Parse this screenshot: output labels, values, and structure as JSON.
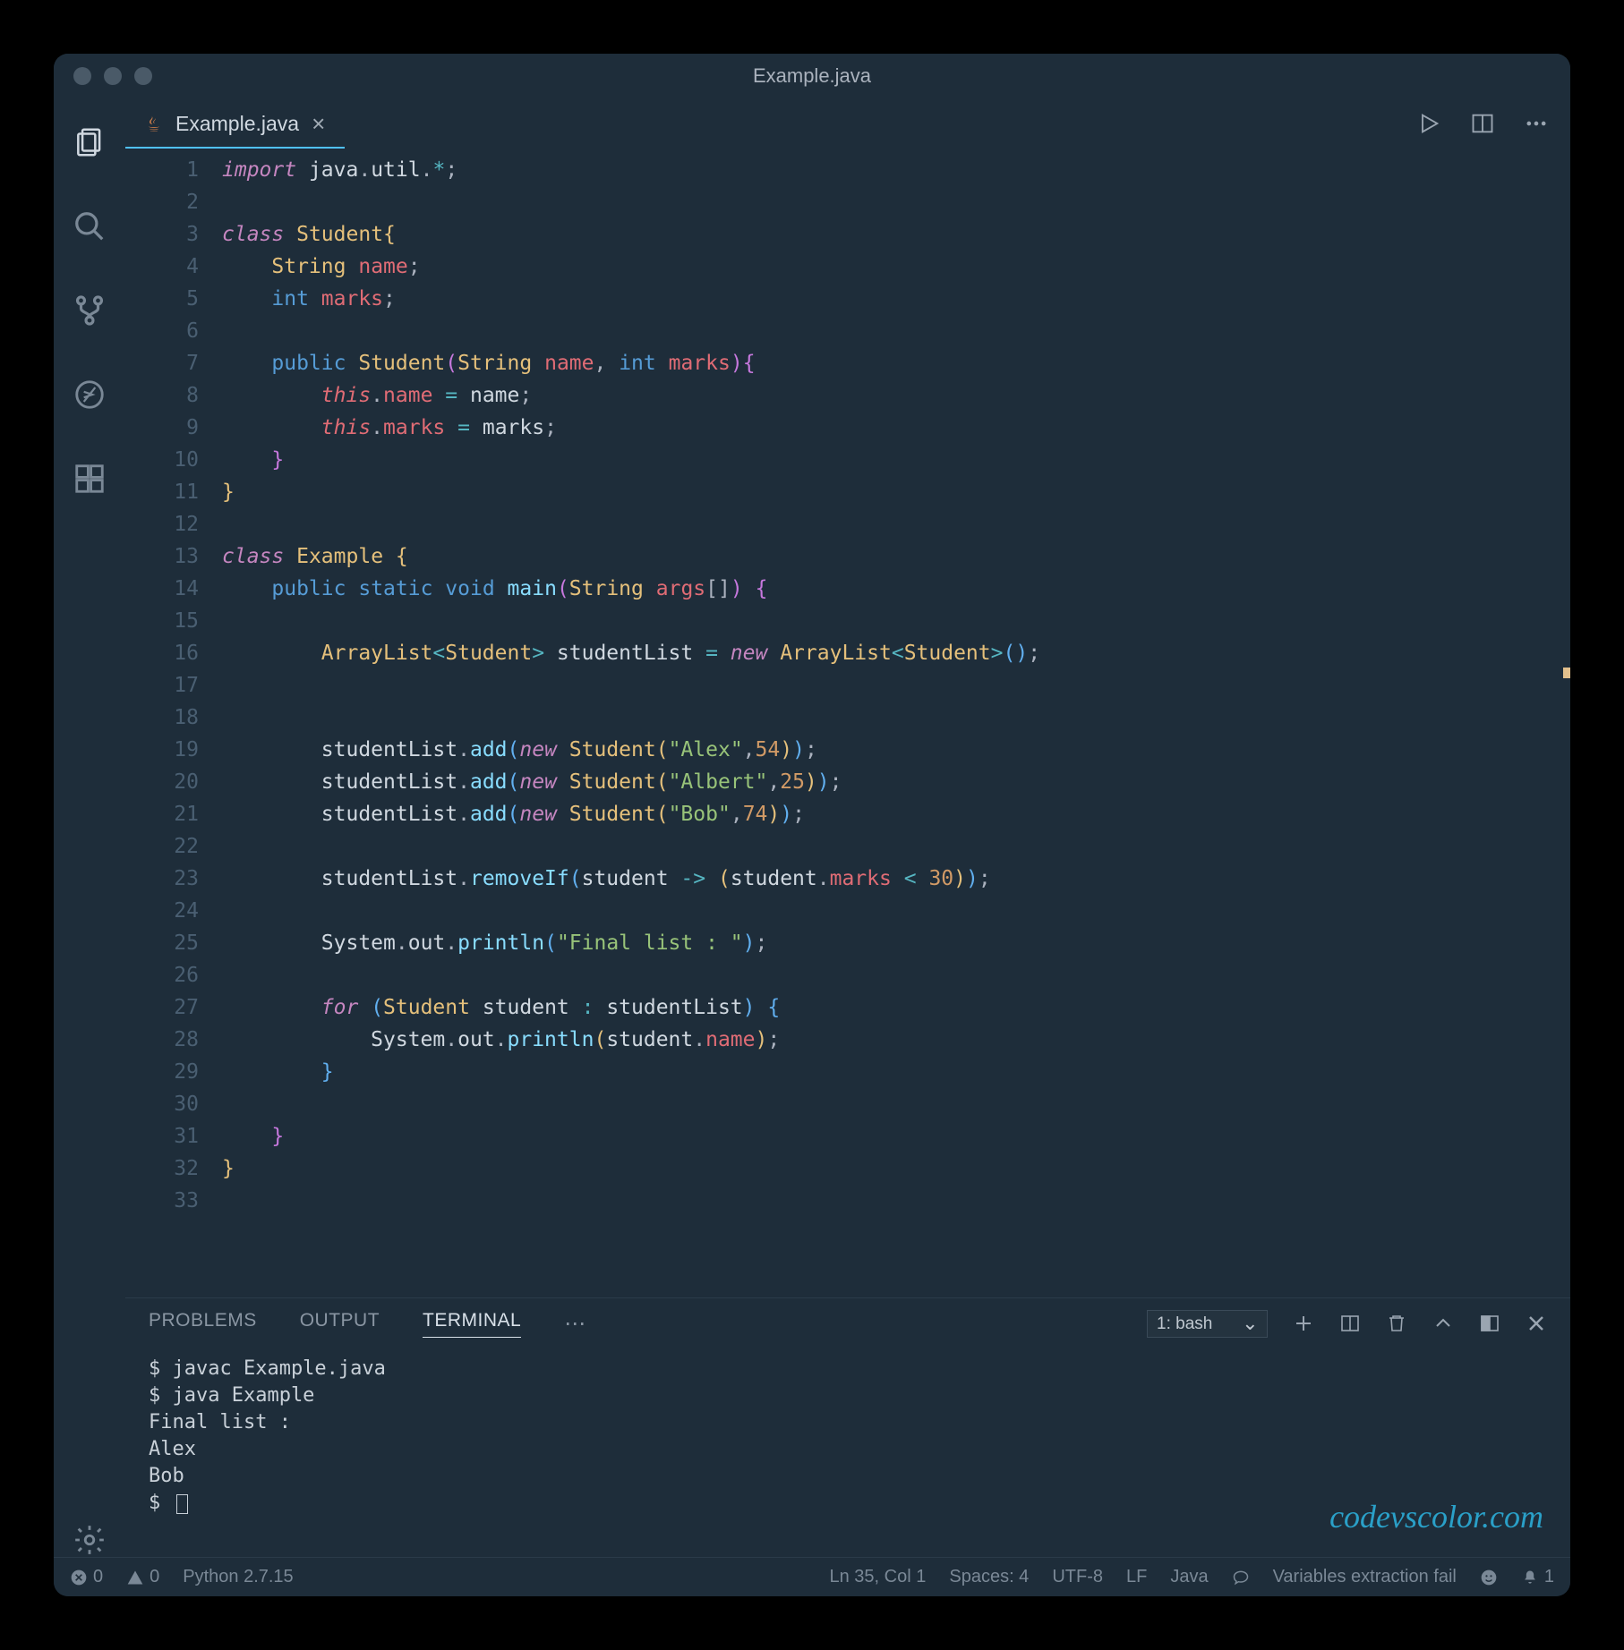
{
  "title": "Example.java",
  "tab": {
    "label": "Example.java"
  },
  "code_lines": [
    [
      [
        "kw",
        "import"
      ],
      [
        "id",
        " java"
      ],
      [
        "punct",
        "."
      ],
      [
        "id",
        "util"
      ],
      [
        "punct",
        "."
      ],
      [
        "op",
        "*"
      ],
      [
        "punct",
        ";"
      ]
    ],
    [],
    [
      [
        "kw",
        "class"
      ],
      [
        "id",
        " "
      ],
      [
        "type",
        "Student"
      ],
      [
        "paren-y",
        "{"
      ]
    ],
    [
      [
        "id",
        "    "
      ],
      [
        "type",
        "String"
      ],
      [
        "id",
        " "
      ],
      [
        "prop",
        "name"
      ],
      [
        "punct",
        ";"
      ]
    ],
    [
      [
        "id",
        "    "
      ],
      [
        "mod",
        "int"
      ],
      [
        "id",
        " "
      ],
      [
        "prop",
        "marks"
      ],
      [
        "punct",
        ";"
      ]
    ],
    [],
    [
      [
        "id",
        "    "
      ],
      [
        "mod",
        "public"
      ],
      [
        "id",
        " "
      ],
      [
        "type",
        "Student"
      ],
      [
        "paren-p",
        "("
      ],
      [
        "type",
        "String"
      ],
      [
        "id",
        " "
      ],
      [
        "prop",
        "name"
      ],
      [
        "punct",
        ","
      ],
      [
        "id",
        " "
      ],
      [
        "mod",
        "int"
      ],
      [
        "id",
        " "
      ],
      [
        "prop",
        "marks"
      ],
      [
        "paren-p",
        ")"
      ],
      [
        "paren-p",
        "{"
      ]
    ],
    [
      [
        "id",
        "        "
      ],
      [
        "self",
        "this"
      ],
      [
        "punct",
        "."
      ],
      [
        "prop",
        "name"
      ],
      [
        "id",
        " "
      ],
      [
        "op",
        "="
      ],
      [
        "id",
        " name"
      ],
      [
        "punct",
        ";"
      ]
    ],
    [
      [
        "id",
        "        "
      ],
      [
        "self",
        "this"
      ],
      [
        "punct",
        "."
      ],
      [
        "prop",
        "marks"
      ],
      [
        "id",
        " "
      ],
      [
        "op",
        "="
      ],
      [
        "id",
        " marks"
      ],
      [
        "punct",
        ";"
      ]
    ],
    [
      [
        "id",
        "    "
      ],
      [
        "paren-p",
        "}"
      ]
    ],
    [
      [
        "paren-y",
        "}"
      ]
    ],
    [],
    [
      [
        "kw",
        "class"
      ],
      [
        "id",
        " "
      ],
      [
        "type",
        "Example"
      ],
      [
        "id",
        " "
      ],
      [
        "paren-y",
        "{"
      ]
    ],
    [
      [
        "id",
        "    "
      ],
      [
        "mod",
        "public"
      ],
      [
        "id",
        " "
      ],
      [
        "mod",
        "static"
      ],
      [
        "id",
        " "
      ],
      [
        "mod",
        "void"
      ],
      [
        "id",
        " "
      ],
      [
        "fn",
        "main"
      ],
      [
        "paren-p",
        "("
      ],
      [
        "type",
        "String"
      ],
      [
        "id",
        " "
      ],
      [
        "prop",
        "args"
      ],
      [
        "punct",
        "[]"
      ],
      [
        "paren-p",
        ")"
      ],
      [
        "id",
        " "
      ],
      [
        "paren-p",
        "{"
      ]
    ],
    [],
    [
      [
        "id",
        "        "
      ],
      [
        "type",
        "ArrayList"
      ],
      [
        "op",
        "<"
      ],
      [
        "type",
        "Student"
      ],
      [
        "op",
        ">"
      ],
      [
        "id",
        " studentList "
      ],
      [
        "op",
        "="
      ],
      [
        "id",
        " "
      ],
      [
        "kw",
        "new"
      ],
      [
        "id",
        " "
      ],
      [
        "type",
        "ArrayList"
      ],
      [
        "op",
        "<"
      ],
      [
        "type",
        "Student"
      ],
      [
        "op",
        ">"
      ],
      [
        "paren-b",
        "()"
      ],
      [
        "punct",
        ";"
      ]
    ],
    [],
    [],
    [
      [
        "id",
        "        studentList"
      ],
      [
        "punct",
        "."
      ],
      [
        "fn",
        "add"
      ],
      [
        "paren-b",
        "("
      ],
      [
        "kw",
        "new"
      ],
      [
        "id",
        " "
      ],
      [
        "type",
        "Student"
      ],
      [
        "paren-y",
        "("
      ],
      [
        "str",
        "\"Alex\""
      ],
      [
        "punct",
        ","
      ],
      [
        "num",
        "54"
      ],
      [
        "paren-y",
        ")"
      ],
      [
        "paren-b",
        ")"
      ],
      [
        "punct",
        ";"
      ]
    ],
    [
      [
        "id",
        "        studentList"
      ],
      [
        "punct",
        "."
      ],
      [
        "fn",
        "add"
      ],
      [
        "paren-b",
        "("
      ],
      [
        "kw",
        "new"
      ],
      [
        "id",
        " "
      ],
      [
        "type",
        "Student"
      ],
      [
        "paren-y",
        "("
      ],
      [
        "str",
        "\"Albert\""
      ],
      [
        "punct",
        ","
      ],
      [
        "num",
        "25"
      ],
      [
        "paren-y",
        ")"
      ],
      [
        "paren-b",
        ")"
      ],
      [
        "punct",
        ";"
      ]
    ],
    [
      [
        "id",
        "        studentList"
      ],
      [
        "punct",
        "."
      ],
      [
        "fn",
        "add"
      ],
      [
        "paren-b",
        "("
      ],
      [
        "kw",
        "new"
      ],
      [
        "id",
        " "
      ],
      [
        "type",
        "Student"
      ],
      [
        "paren-y",
        "("
      ],
      [
        "str",
        "\"Bob\""
      ],
      [
        "punct",
        ","
      ],
      [
        "num",
        "74"
      ],
      [
        "paren-y",
        ")"
      ],
      [
        "paren-b",
        ")"
      ],
      [
        "punct",
        ";"
      ]
    ],
    [],
    [
      [
        "id",
        "        studentList"
      ],
      [
        "punct",
        "."
      ],
      [
        "fn",
        "removeIf"
      ],
      [
        "paren-b",
        "("
      ],
      [
        "id",
        "student "
      ],
      [
        "op",
        "->"
      ],
      [
        "id",
        " "
      ],
      [
        "paren-y",
        "("
      ],
      [
        "id",
        "student"
      ],
      [
        "punct",
        "."
      ],
      [
        "prop",
        "marks"
      ],
      [
        "id",
        " "
      ],
      [
        "op",
        "<"
      ],
      [
        "id",
        " "
      ],
      [
        "num",
        "30"
      ],
      [
        "paren-y",
        ")"
      ],
      [
        "paren-b",
        ")"
      ],
      [
        "punct",
        ";"
      ]
    ],
    [],
    [
      [
        "id",
        "        System"
      ],
      [
        "punct",
        "."
      ],
      [
        "id",
        "out"
      ],
      [
        "punct",
        "."
      ],
      [
        "fn",
        "println"
      ],
      [
        "paren-b",
        "("
      ],
      [
        "str",
        "\"Final list : \""
      ],
      [
        "paren-b",
        ")"
      ],
      [
        "punct",
        ";"
      ]
    ],
    [],
    [
      [
        "id",
        "        "
      ],
      [
        "kw",
        "for"
      ],
      [
        "id",
        " "
      ],
      [
        "paren-b",
        "("
      ],
      [
        "type",
        "Student"
      ],
      [
        "id",
        " student "
      ],
      [
        "op",
        ":"
      ],
      [
        "id",
        " studentList"
      ],
      [
        "paren-b",
        ")"
      ],
      [
        "id",
        " "
      ],
      [
        "paren-b",
        "{"
      ]
    ],
    [
      [
        "id",
        "            System"
      ],
      [
        "punct",
        "."
      ],
      [
        "id",
        "out"
      ],
      [
        "punct",
        "."
      ],
      [
        "fn",
        "println"
      ],
      [
        "paren-y",
        "("
      ],
      [
        "id",
        "student"
      ],
      [
        "punct",
        "."
      ],
      [
        "prop",
        "name"
      ],
      [
        "paren-y",
        ")"
      ],
      [
        "punct",
        ";"
      ]
    ],
    [
      [
        "id",
        "        "
      ],
      [
        "paren-b",
        "}"
      ]
    ],
    [],
    [
      [
        "id",
        "    "
      ],
      [
        "paren-p",
        "}"
      ]
    ],
    [
      [
        "paren-y",
        "}"
      ]
    ],
    []
  ],
  "panel": {
    "tabs": [
      "PROBLEMS",
      "OUTPUT",
      "TERMINAL"
    ],
    "active": "TERMINAL",
    "select": "1: bash",
    "terminal_lines": [
      "$ javac Example.java",
      "$ java Example",
      "Final list :",
      "Alex",
      "Bob"
    ],
    "prompt": "$ "
  },
  "watermark": "codevscolor.com",
  "status": {
    "errors": "0",
    "warnings": "0",
    "interpreter": "Python 2.7.15",
    "position": "Ln 35, Col 1",
    "spaces": "Spaces: 4",
    "encoding": "UTF-8",
    "eol": "LF",
    "language": "Java",
    "msg": "Variables extraction fail",
    "bell": "1"
  }
}
